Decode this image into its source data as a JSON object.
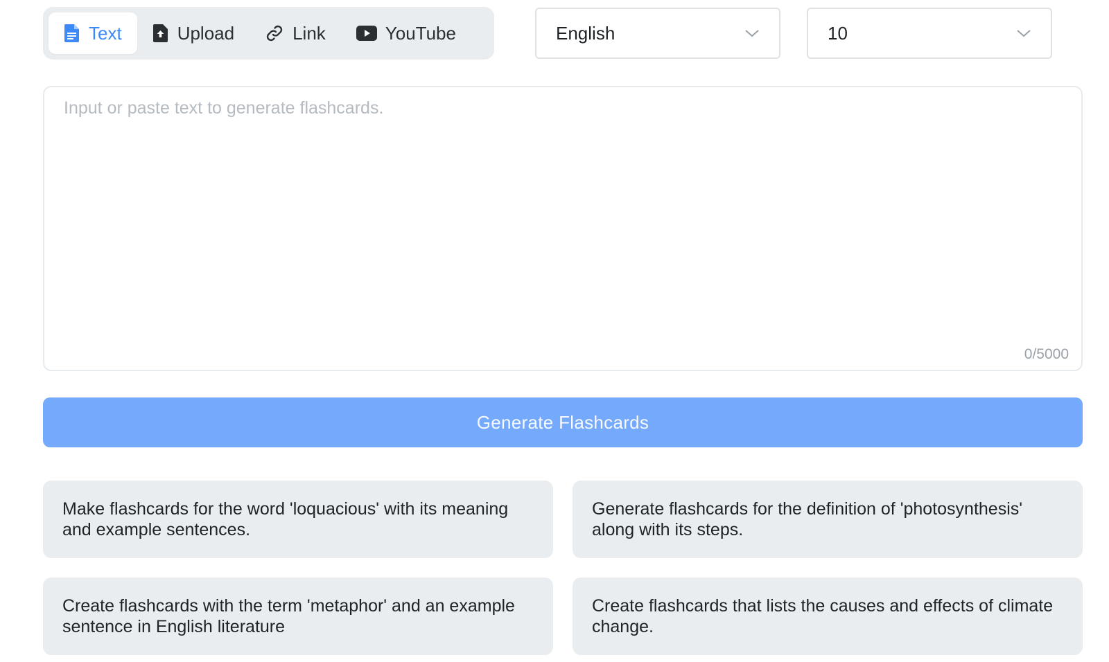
{
  "tabs": [
    {
      "label": "Text",
      "icon": "document-icon",
      "active": true
    },
    {
      "label": "Upload",
      "icon": "upload-icon",
      "active": false
    },
    {
      "label": "Link",
      "icon": "link-icon",
      "active": false
    },
    {
      "label": "YouTube",
      "icon": "youtube-icon",
      "active": false
    }
  ],
  "language_select": {
    "value": "English"
  },
  "count_select": {
    "value": "10"
  },
  "input": {
    "placeholder": "Input or paste text to generate flashcards.",
    "value": "",
    "counter": "0/5000"
  },
  "generate_button": {
    "label": "Generate Flashcards"
  },
  "suggestions": [
    "Make flashcards for the word 'loquacious' with its meaning and example sentences.",
    "Generate flashcards for the definition of 'photosynthesis' along with its steps.",
    "Create flashcards with the term 'metaphor' and an example sentence in English literature",
    "Create flashcards that lists the causes and effects of climate change."
  ],
  "colors": {
    "accent": "#3d8af7",
    "button_bg": "#74a9fb",
    "panel_bg": "#eaedef"
  }
}
